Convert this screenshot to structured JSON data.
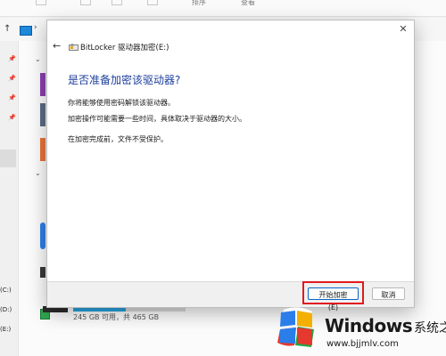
{
  "background_explorer": {
    "toolbar_partial_labels": [
      "排序",
      "查看"
    ],
    "sidebar_drive_labels": [
      "(C:)",
      "(D:)",
      "(E:)"
    ],
    "drive_info": "245 GB 可用，共 465 GB",
    "drive_usage_fraction": 0.47
  },
  "dialog": {
    "title": "BitLocker 驱动器加密(E:)",
    "heading": "是否准备加密该驱动器?",
    "paragraphs": [
      "你将能够使用密码解锁该驱动器。",
      "加密操作可能需要一些时间，具体取决于驱动器的大小。",
      "在加密完成前，文件不受保护。"
    ],
    "buttons": {
      "start": "开始加密(E)",
      "cancel": "取消"
    }
  },
  "watermark": {
    "brand": "Windows",
    "brand_cn": "系统之家",
    "url": "www.bjjmlv.com"
  },
  "colors": {
    "heading": "#1e3f9e",
    "highlight_box": "#e0191d",
    "accent": "#0a64c8"
  }
}
